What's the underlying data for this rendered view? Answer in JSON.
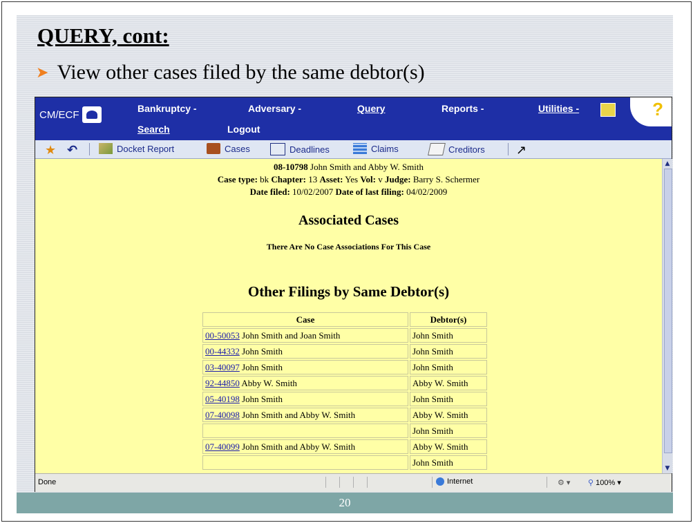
{
  "slide": {
    "title": "QUERY, cont:",
    "bullet": "View other cases filed by the same debtor(s)",
    "page_number": "20"
  },
  "app": {
    "logo_text": "CM/ECF",
    "menu": {
      "bankruptcy": "Bankruptcy -",
      "adversary": "Adversary -",
      "query": "Query",
      "reports": "Reports -",
      "utilities": "Utilities -",
      "search": "Search",
      "logout": "Logout"
    },
    "help_glyph": "?"
  },
  "toolbar": {
    "docket_report": "Docket Report",
    "cases": "Cases",
    "deadlines": "Deadlines",
    "claims": "Claims",
    "creditors": "Creditors"
  },
  "case": {
    "number": "08-10798",
    "debtors": "John Smith and Abby W. Smith",
    "type_label": "Case type:",
    "type": "bk",
    "chapter_label": "Chapter:",
    "chapter": "13",
    "asset_label": "Asset:",
    "asset": "Yes",
    "vol_label": "Vol:",
    "vol": "v",
    "judge_label": "Judge:",
    "judge": "Barry S. Schermer",
    "date_filed_label": "Date filed:",
    "date_filed": "10/02/2007",
    "last_filing_label": "Date of last filing:",
    "last_filing": "04/02/2009"
  },
  "associated": {
    "title": "Associated Cases",
    "note": "There Are No Case Associations For This Case"
  },
  "other_filings": {
    "title": "Other Filings by Same Debtor(s)",
    "col_case": "Case",
    "col_debtors": "Debtor(s)",
    "rows": [
      {
        "number": "00-50053",
        "name": "John Smith and Joan Smith",
        "debtor": "John Smith"
      },
      {
        "number": "00-44332",
        "name": "John Smith",
        "debtor": "John Smith"
      },
      {
        "number": "03-40097",
        "name": "John Smith",
        "debtor": "John Smith"
      },
      {
        "number": "92-44850",
        "name": "Abby W. Smith",
        "debtor": "Abby W. Smith"
      },
      {
        "number": "05-40198",
        "name": "John Smith",
        "debtor": "John Smith"
      },
      {
        "number": "07-40098",
        "name": "John Smith and Abby W. Smith",
        "debtor": "Abby W. Smith"
      },
      {
        "number": "",
        "name": "",
        "debtor": "John Smith"
      },
      {
        "number": "07-40099",
        "name": "John Smith and Abby W. Smith",
        "debtor": "Abby W. Smith"
      },
      {
        "number": "",
        "name": "",
        "debtor": "John Smith"
      }
    ]
  },
  "statusbar": {
    "status": "Done",
    "zone": "Internet",
    "zoom": "100%"
  },
  "colors": {
    "menubar": "#1e2fa6",
    "content_bg": "#ffffa6",
    "link": "#1a1aaa",
    "footer": "#7ea6a6",
    "bullet_arrow": "#f08020"
  }
}
